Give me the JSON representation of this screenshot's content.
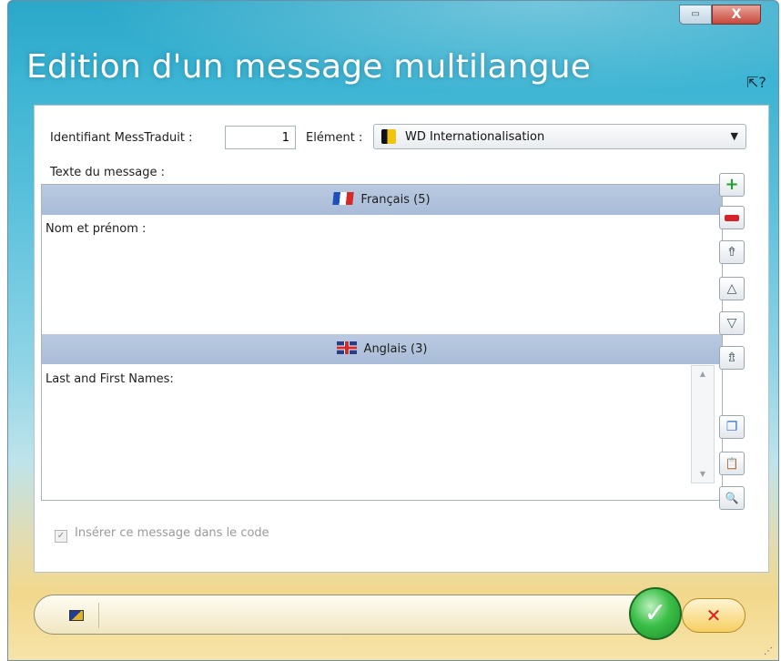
{
  "window": {
    "title": "Edition d'un message multilangue",
    "minimize_glyph": "▭",
    "close_glyph": "X",
    "help_cursor_glyph": "⇱?"
  },
  "form": {
    "id_label": "Identifiant MessTraduit :",
    "id_value": "1",
    "element_label": "Elément :",
    "element_value": "WD Internationalisation",
    "message_label": "Texte du message :"
  },
  "languages": [
    {
      "name": "Français (5)",
      "flag": "flag-fr-icon",
      "text": "Nom et prénom :"
    },
    {
      "name": "Anglais (3)",
      "flag": "flag-uk-icon",
      "text": "Last and First Names:"
    }
  ],
  "side_buttons": [
    {
      "name": "add-language-button",
      "icon": "plus-icon",
      "glyph": "+"
    },
    {
      "name": "remove-language-button",
      "icon": "minus-icon",
      "glyph": ""
    },
    {
      "name": "move-top-button",
      "icon": "double-chevron-up-icon",
      "glyph": "⇮"
    },
    {
      "name": "move-up-button",
      "icon": "chevron-up-icon",
      "glyph": "△"
    },
    {
      "name": "move-down-button",
      "icon": "chevron-down-icon",
      "glyph": "▽"
    },
    {
      "name": "move-bottom-button",
      "icon": "double-chevron-down-icon",
      "glyph": "⇯"
    },
    {
      "name": "copy-button",
      "icon": "copy-icon",
      "glyph": "❐"
    },
    {
      "name": "paste-button",
      "icon": "paste-icon",
      "glyph": "📋"
    },
    {
      "name": "search-button",
      "icon": "magnifier-icon",
      "glyph": "🔍"
    }
  ],
  "checkbox": {
    "label": "Insérer ce message dans le code",
    "checked_glyph": "✓"
  },
  "footer": {
    "ok_glyph": "✓",
    "cancel_glyph": "✕",
    "grip_glyph": "⋰"
  },
  "colors": {
    "header_bar": "#b3c5de",
    "ok_green": "#3bbf48",
    "cancel_red": "#e01b1b",
    "sky_blue": "#2aa7c9"
  }
}
